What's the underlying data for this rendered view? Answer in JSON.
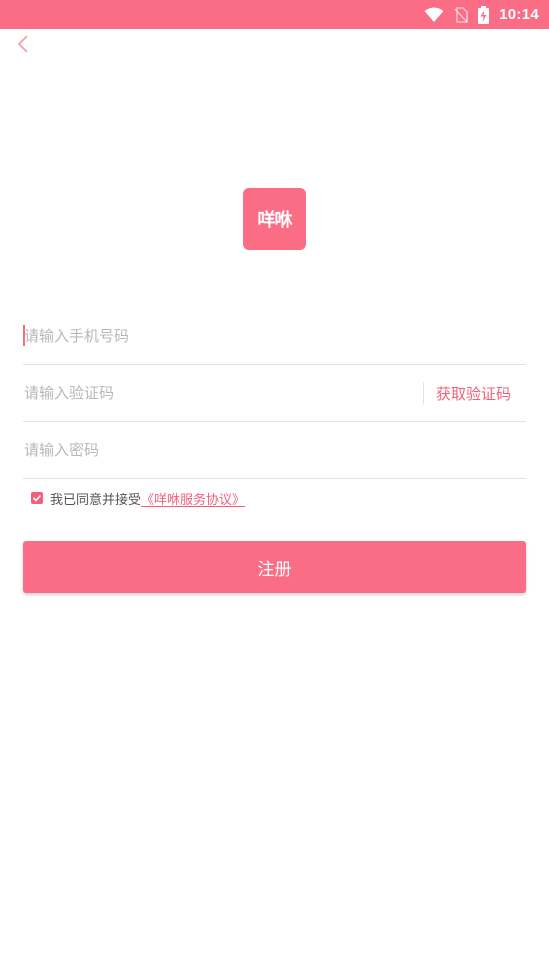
{
  "status_bar": {
    "time": "10:14",
    "icons": [
      "wifi-icon",
      "no-sim-icon",
      "battery-charging-icon"
    ],
    "background": "#fb6c85"
  },
  "header": {
    "back_icon": "chevron-left-icon"
  },
  "logo": {
    "text": "咩咻"
  },
  "form": {
    "phone_placeholder": "请输入手机号码",
    "phone_value": "",
    "code_placeholder": "请输入验证码",
    "code_value": "",
    "get_code_label": "获取验证码",
    "password_placeholder": "请输入密码",
    "password_value": ""
  },
  "agreement": {
    "checked": true,
    "text": "我已同意并接受",
    "link": "《咩咻服务协议》"
  },
  "register_button": {
    "label": "注册"
  },
  "colors": {
    "accent": "#fb6c85",
    "link": "#f2607b",
    "placeholder": "#b8b8b8",
    "divider": "#e4e4e4"
  }
}
